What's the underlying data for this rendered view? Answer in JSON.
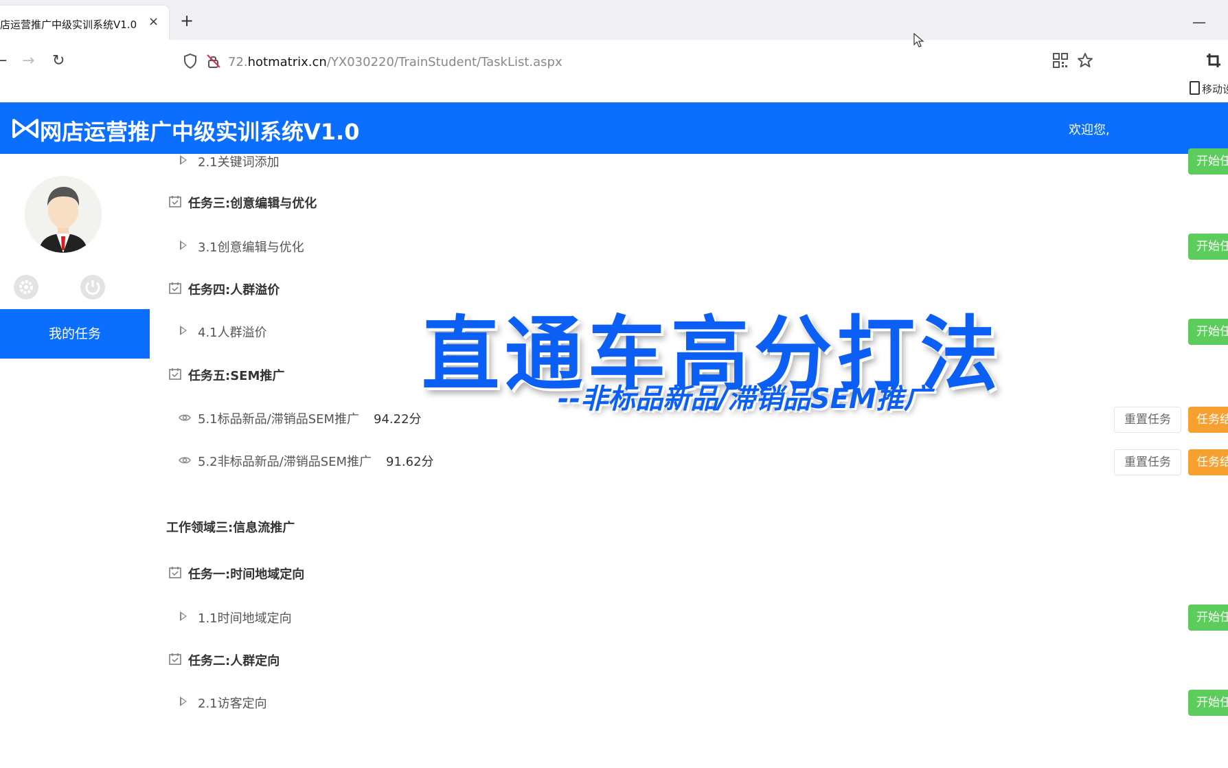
{
  "browser": {
    "tab_title": "店运营推广中级实训系统V1.0",
    "tab_close": "×",
    "new_tab": "+",
    "minimize": "—",
    "back": "←",
    "forward": "→",
    "reload": "↻",
    "url_prefix": "72.",
    "url_host": "hotmatrix.cn",
    "url_path": "/YX030220/TrainStudent/TaskList.aspx",
    "bookmark_label": "移动设"
  },
  "header": {
    "title": "网店运营推广中级实训系统V1.0",
    "welcome": "欢迎您,",
    "color": "#0b6efd"
  },
  "sidebar": {
    "menu_active": "我的任务"
  },
  "content": {
    "rows": [
      {
        "kind": "sub",
        "icon": "triangle",
        "label": "2.1关键词添加",
        "action": "开始任务"
      },
      {
        "kind": "task",
        "label": "任务三:创意编辑与优化"
      },
      {
        "kind": "sub",
        "icon": "triangle",
        "label": "3.1创意编辑与优化",
        "action": "开始任务"
      },
      {
        "kind": "task",
        "label": "任务四:人群溢价"
      },
      {
        "kind": "sub",
        "icon": "triangle",
        "label": "4.1人群溢价",
        "action": "开始任务"
      },
      {
        "kind": "task",
        "label": "任务五:SEM推广"
      },
      {
        "kind": "sub",
        "icon": "eye",
        "label": "5.1标品新品/滞销品SEM推广",
        "score": "94.22分",
        "reset": "重置任务",
        "action": "任务结果"
      },
      {
        "kind": "sub",
        "icon": "eye",
        "label": "5.2非标品新品/滞销品SEM推广",
        "score": "91.62分",
        "reset": "重置任务",
        "action": "任务结果"
      },
      {
        "kind": "area",
        "label": "工作领域三:信息流推广"
      },
      {
        "kind": "task",
        "label": "任务一:时间地域定向"
      },
      {
        "kind": "sub",
        "icon": "triangle",
        "label": "1.1时间地域定向",
        "action": "开始任务"
      },
      {
        "kind": "task",
        "label": "任务二:人群定向"
      },
      {
        "kind": "sub",
        "icon": "triangle",
        "label": "2.1访客定向",
        "action": "开始任务"
      }
    ]
  },
  "overlay": {
    "title": "直通车高分打法",
    "subtitle": "--非标品新品/滞销品SEM推广",
    "color": "#0b5ff5"
  }
}
